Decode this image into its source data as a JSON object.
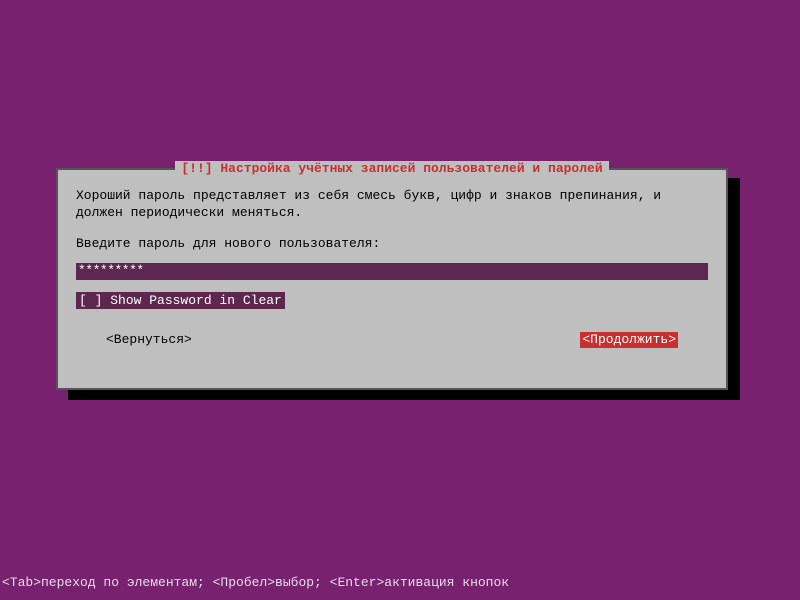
{
  "dialog": {
    "title": "[!!] Настройка учётных записей пользователей и паролей",
    "description": "Хороший пароль представляет из себя смесь букв, цифр и знаков препинания, и должен периодически меняться.",
    "prompt": "Введите пароль для нового пользователя:",
    "password_value": "*********",
    "checkbox_state": "[ ]",
    "checkbox_label": "Show Password in Clear",
    "back_label": "<Вернуться>",
    "continue_label": "<Продолжить>"
  },
  "footer": {
    "hint": "<Tab>переход по элементам; <Пробел>выбор; <Enter>активация кнопок"
  }
}
